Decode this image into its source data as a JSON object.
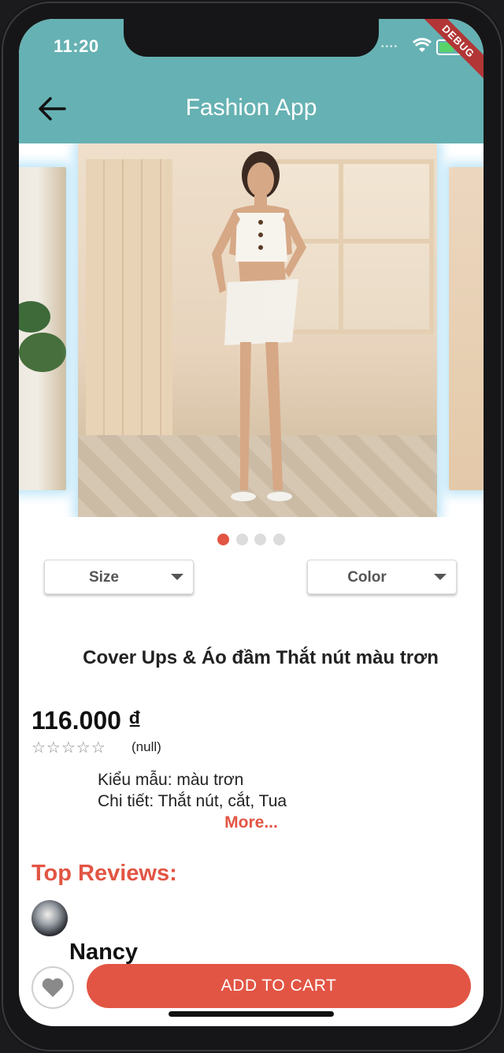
{
  "status_bar": {
    "time": "11:20",
    "debug_banner": "DEBUG"
  },
  "header": {
    "title": "Fashion App"
  },
  "carousel": {
    "page_count": 4,
    "active_index": 0
  },
  "filters": {
    "size_label": "Size",
    "color_label": "Color"
  },
  "product": {
    "name": "Cover Ups & Áo đầm Thắt nút màu trơn",
    "price": "116.000 ₫",
    "stars": "☆☆☆☆☆",
    "rating_text": "(null)",
    "detail_line1": "Kiểu mẫu: màu trơn",
    "detail_line2": "Chi tiết: Thắt nút, cắt, Tua",
    "more_label": "More..."
  },
  "reviews": {
    "title": "Top Reviews:",
    "first_reviewer": "Nancy"
  },
  "actions": {
    "add_to_cart_label": "ADD TO CART"
  },
  "colors": {
    "appbar": "#66b1b3",
    "accent": "#e25544"
  }
}
